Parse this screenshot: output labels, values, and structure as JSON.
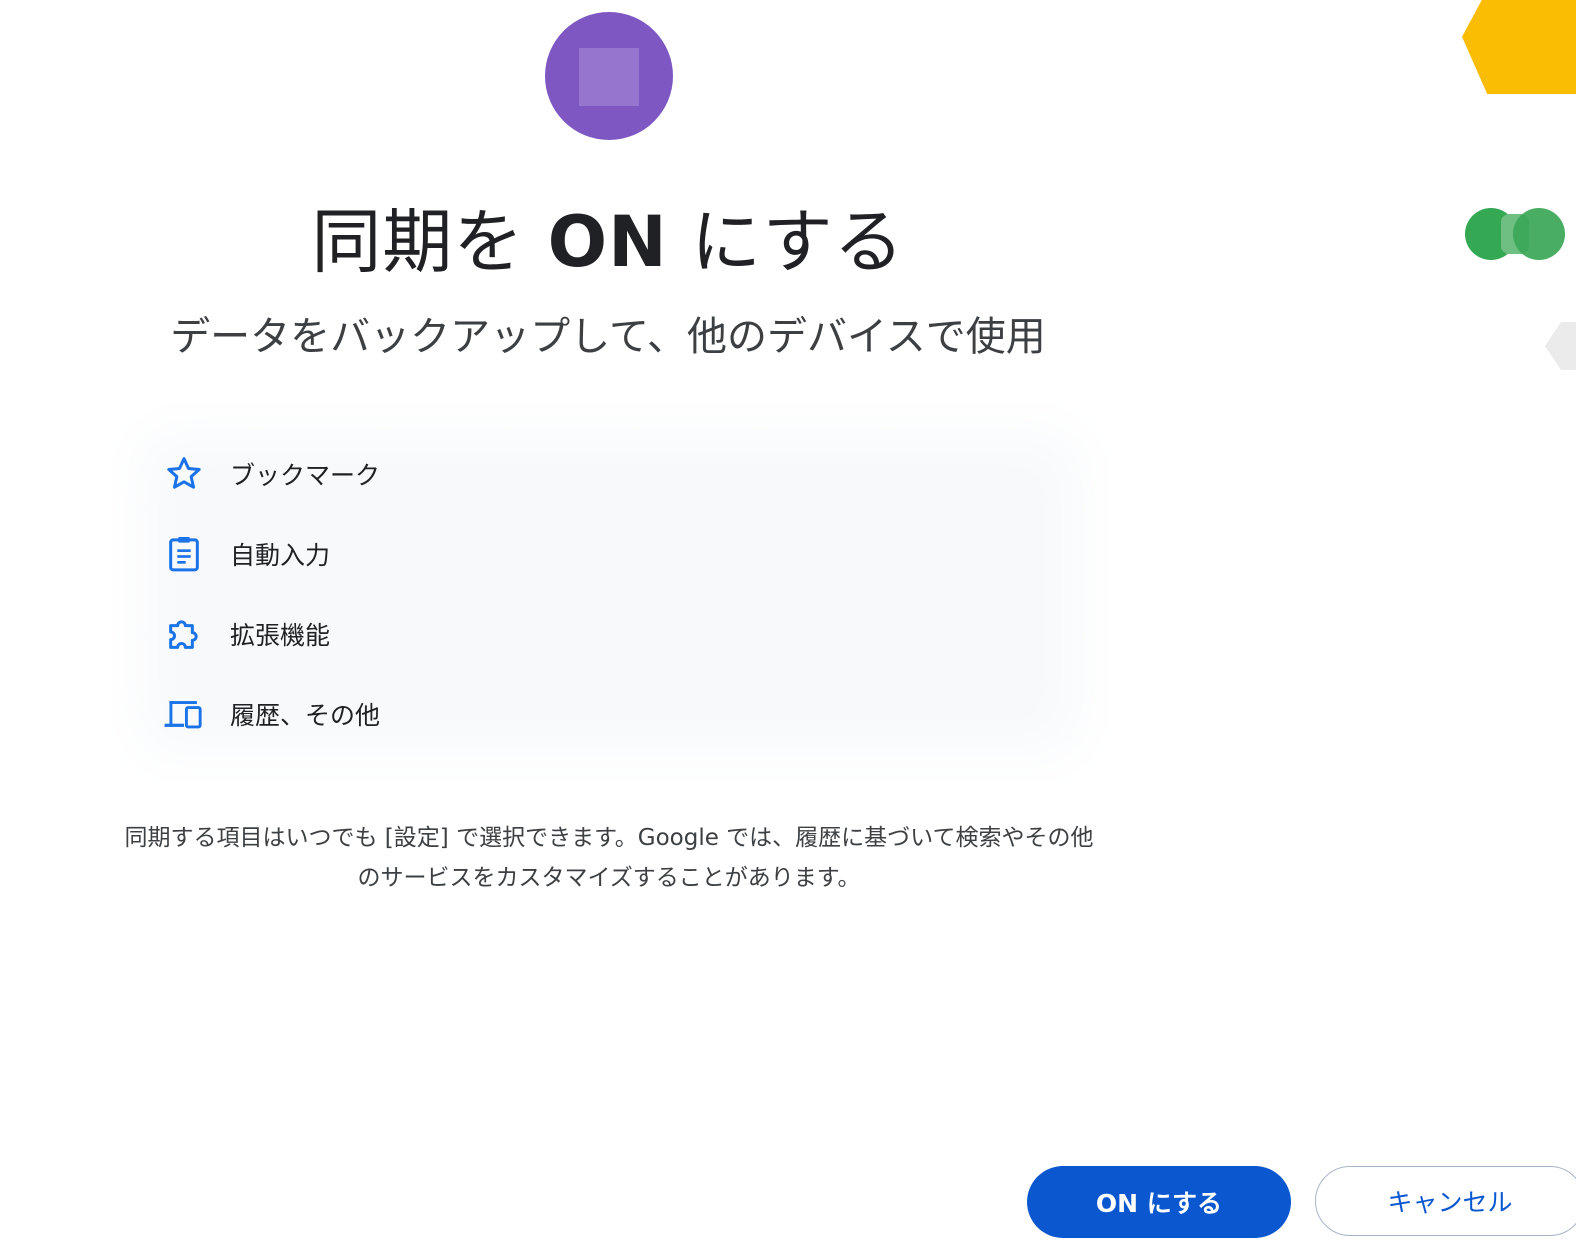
{
  "dialog": {
    "title_prefix": "同期を ",
    "title_bold": "ON",
    "title_suffix": " にする",
    "subtitle": "データをバックアップして、他のデバイスで使用"
  },
  "features": [
    {
      "label": "ブックマーク",
      "icon": "star-icon"
    },
    {
      "label": "自動入力",
      "icon": "clipboard-icon"
    },
    {
      "label": "拡張機能",
      "icon": "puzzle-icon"
    },
    {
      "label": "履歴、その他",
      "icon": "devices-icon"
    }
  ],
  "disclaimer": {
    "line1": "同期する項目はいつでも [設定] で選択できます。Google では、履歴に基づいて検索やその他",
    "line2": "のサービスをカスタマイズすることがあります。"
  },
  "buttons": {
    "confirm_label": "ON にする",
    "cancel_label": "キャンセル"
  },
  "colors": {
    "accent": "#0b57d0",
    "icon": "#1a73e8",
    "avatar": "#7e57c2",
    "deco_yellow": "#fbbc04",
    "deco_green": "#34a853"
  }
}
